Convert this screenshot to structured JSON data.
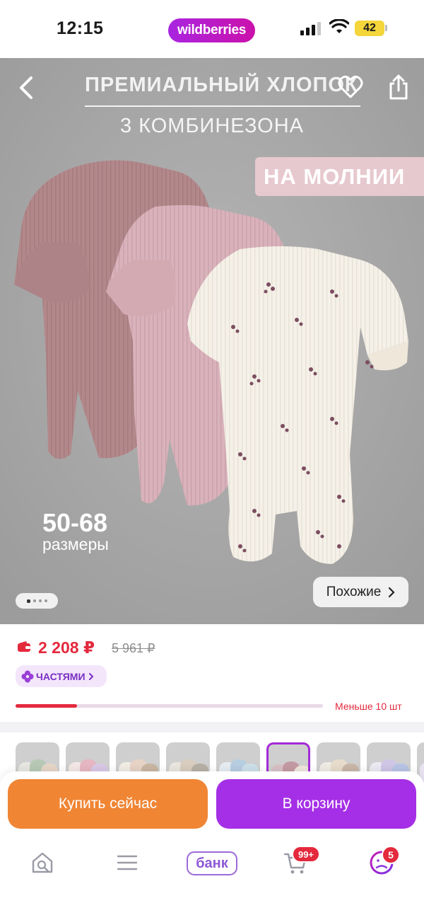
{
  "status_bar": {
    "time": "12:15",
    "brand_pill": "wildberries",
    "battery": "42",
    "icons": [
      "signal-icon",
      "wifi-icon",
      "battery-icon"
    ]
  },
  "hero": {
    "title": "ПРЕМИАЛЬНЫЙ ХЛОПОК",
    "subtitle": "3 КОМБИНЕЗОНА",
    "badge": "НА МОЛНИИ",
    "sizes_number": "50-68",
    "sizes_label": "размеры",
    "similar_button": "Похожие",
    "gallery_total": 4,
    "gallery_active": 1,
    "icons": [
      "back-arrow-icon",
      "heart-icon",
      "share-icon",
      "chevron-right-icon"
    ]
  },
  "price": {
    "current": "2 208 ₽",
    "old": "5 961 ₽",
    "installments_label": "ЧАСТЯМИ",
    "stock_text": "Меньше 10 шт",
    "stock_level": 0.2,
    "icons": [
      "wallet-icon",
      "installments-icon"
    ]
  },
  "variants": {
    "count": 9,
    "selected_index": 5
  },
  "actions": {
    "buy_now": "Купить сейчас",
    "add_to_cart": "В корзину"
  },
  "bottom_nav": {
    "bank_label": "банк",
    "cart_badge": "99+",
    "profile_badge": "5",
    "icons": [
      "home-search-icon",
      "menu-icon",
      "bank-icon",
      "cart-icon",
      "profile-icon"
    ]
  },
  "colors": {
    "brand_gradient_start": "#a925e0",
    "brand_gradient_end": "#cb11ab",
    "price_red": "#e4293d",
    "buy_now_orange": "#f08534",
    "cart_purple": "#a52fe6"
  }
}
